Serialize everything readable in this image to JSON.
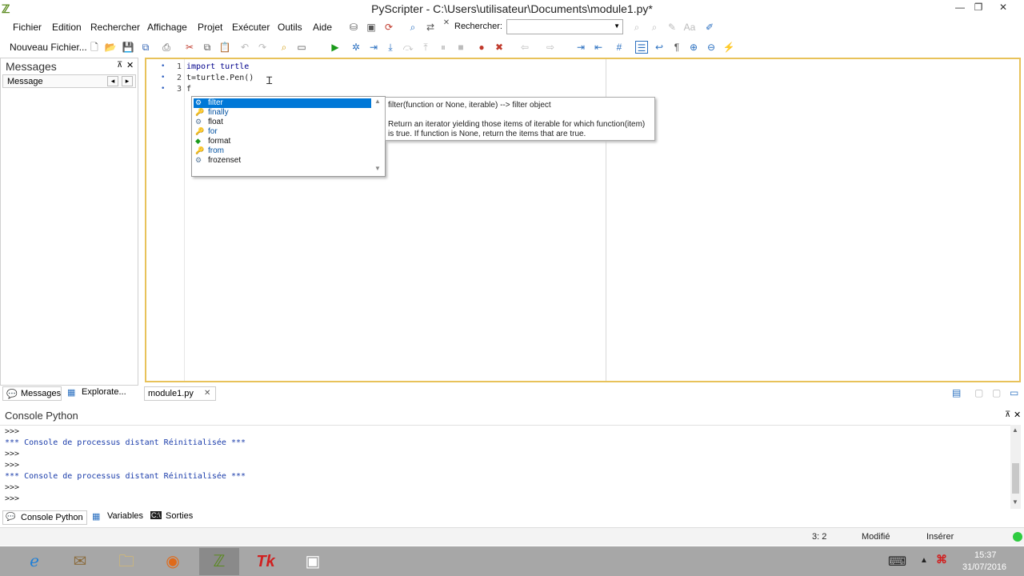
{
  "window": {
    "title": "PyScripter - C:\\Users\\utilisateur\\Documents\\module1.py*",
    "minimize": "—",
    "restore": "❐",
    "close": "✕"
  },
  "menu": [
    "Fichier",
    "Edition",
    "Rechercher",
    "Affichage",
    "Projet",
    "Exécuter",
    "Outils",
    "Aide"
  ],
  "search": {
    "label": "Rechercher:",
    "value": ""
  },
  "toolbar": {
    "new_file_label": "Nouveau Fichier..."
  },
  "messages_panel": {
    "title": "Messages",
    "column_header": "Message"
  },
  "editor": {
    "lines": [
      {
        "num": "1",
        "text": "import turtle"
      },
      {
        "num": "2",
        "text": "t=turtle.Pen()"
      },
      {
        "num": "3",
        "text": "f"
      }
    ]
  },
  "autocomplete": {
    "items": [
      {
        "label": "filter",
        "icon": "function-icon",
        "selected": true
      },
      {
        "label": "finally",
        "icon": "keyword-icon",
        "selected": false
      },
      {
        "label": "float",
        "icon": "class-icon",
        "selected": false
      },
      {
        "label": "for",
        "icon": "keyword-icon",
        "selected": false
      },
      {
        "label": "format",
        "icon": "function-icon",
        "selected": false
      },
      {
        "label": "from",
        "icon": "keyword-icon",
        "selected": false
      },
      {
        "label": "frozenset",
        "icon": "class-icon",
        "selected": false
      }
    ],
    "tooltip_signature": "filter(function or None, iterable) --> filter object",
    "tooltip_doc_1": "Return an iterator yielding those items of iterable for which function(item)",
    "tooltip_doc_2": "is true. If function is None, return the items that are true."
  },
  "left_tabs": {
    "messages": "Messages",
    "explorer": "Explorate..."
  },
  "editor_tab": {
    "label": "module1.py"
  },
  "console": {
    "title": "Console Python",
    "lines": [
      {
        "text": ">>>",
        "kind": "prompt"
      },
      {
        "text": "*** Console de processus distant Réinitialisée ***",
        "kind": "msg"
      },
      {
        "text": ">>>",
        "kind": "prompt"
      },
      {
        "text": ">>>",
        "kind": "prompt"
      },
      {
        "text": "*** Console de processus distant Réinitialisée ***",
        "kind": "msg"
      },
      {
        "text": ">>>",
        "kind": "prompt"
      },
      {
        "text": ">>>",
        "kind": "prompt"
      }
    ]
  },
  "bottom_tabs": {
    "console": "Console Python",
    "variables": "Variables",
    "sorties": "Sorties"
  },
  "status": {
    "position": "3: 2",
    "modified": "Modifié",
    "mode": "Insérer"
  },
  "taskbar": {
    "time": "15:37",
    "date": "31/07/2016"
  },
  "colors": {
    "accent_selection": "#0078d7",
    "editor_border": "#e8c25a",
    "console_msg": "#1a3caa"
  }
}
